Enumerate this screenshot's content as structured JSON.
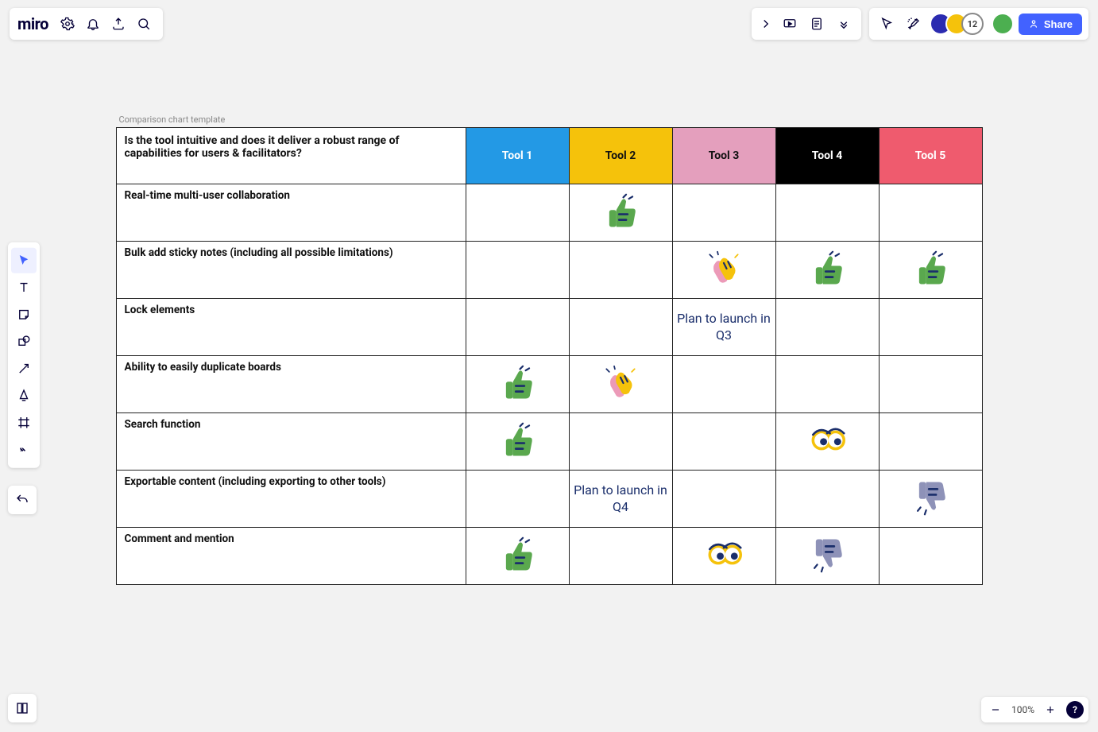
{
  "app": {
    "name": "miro"
  },
  "board": {
    "title": "Comparison chart template",
    "feature_question": "Is the tool intuitive and does it deliver a robust range of capabilities for users & facilitators?"
  },
  "columns": [
    {
      "label": "Tool 1",
      "bg": "#2399e5",
      "fg": "#ffffff"
    },
    {
      "label": "Tool 2",
      "bg": "#f5c20b",
      "fg": "#111111"
    },
    {
      "label": "Tool 3",
      "bg": "#e49fbd",
      "fg": "#111111"
    },
    {
      "label": "Tool 4",
      "bg": "#000000",
      "fg": "#ffffff"
    },
    {
      "label": "Tool 5",
      "bg": "#ef5b6e",
      "fg": "#ffffff"
    }
  ],
  "rows": [
    {
      "label": "Real-time multi-user collaboration",
      "cells": [
        {
          "type": "empty"
        },
        {
          "type": "sticker",
          "icon": "thumbs-up"
        },
        {
          "type": "empty"
        },
        {
          "type": "empty"
        },
        {
          "type": "empty"
        }
      ]
    },
    {
      "label": "Bulk add sticky notes (including all possible limitations)",
      "cells": [
        {
          "type": "empty"
        },
        {
          "type": "empty"
        },
        {
          "type": "sticker",
          "icon": "clap"
        },
        {
          "type": "sticker",
          "icon": "thumbs-up"
        },
        {
          "type": "sticker",
          "icon": "thumbs-up"
        }
      ]
    },
    {
      "label": "Lock elements",
      "cells": [
        {
          "type": "empty"
        },
        {
          "type": "empty"
        },
        {
          "type": "text",
          "text": "Plan to launch in Q3"
        },
        {
          "type": "empty"
        },
        {
          "type": "empty"
        }
      ]
    },
    {
      "label": "Ability to easily duplicate boards",
      "cells": [
        {
          "type": "sticker",
          "icon": "thumbs-up"
        },
        {
          "type": "sticker",
          "icon": "clap"
        },
        {
          "type": "empty"
        },
        {
          "type": "empty"
        },
        {
          "type": "empty"
        }
      ]
    },
    {
      "label": "Search function",
      "cells": [
        {
          "type": "sticker",
          "icon": "thumbs-up"
        },
        {
          "type": "empty"
        },
        {
          "type": "empty"
        },
        {
          "type": "sticker",
          "icon": "eyes"
        },
        {
          "type": "empty"
        }
      ]
    },
    {
      "label": "Exportable content (including exporting to other tools)",
      "cells": [
        {
          "type": "empty"
        },
        {
          "type": "text",
          "text": "Plan to launch in Q4"
        },
        {
          "type": "empty"
        },
        {
          "type": "empty"
        },
        {
          "type": "sticker",
          "icon": "thumbs-down"
        }
      ]
    },
    {
      "label": "Comment and mention",
      "cells": [
        {
          "type": "sticker",
          "icon": "thumbs-up"
        },
        {
          "type": "empty"
        },
        {
          "type": "sticker",
          "icon": "eyes"
        },
        {
          "type": "sticker",
          "icon": "thumbs-down"
        },
        {
          "type": "empty"
        }
      ]
    }
  ],
  "topbar": {
    "share_label": "Share",
    "overflow_count": "12"
  },
  "avatars": [
    {
      "bg": "#2b2bb0"
    },
    {
      "bg": "#f5c20b"
    },
    {
      "bg": "#4caf50"
    }
  ],
  "zoom": {
    "level": "100%"
  }
}
